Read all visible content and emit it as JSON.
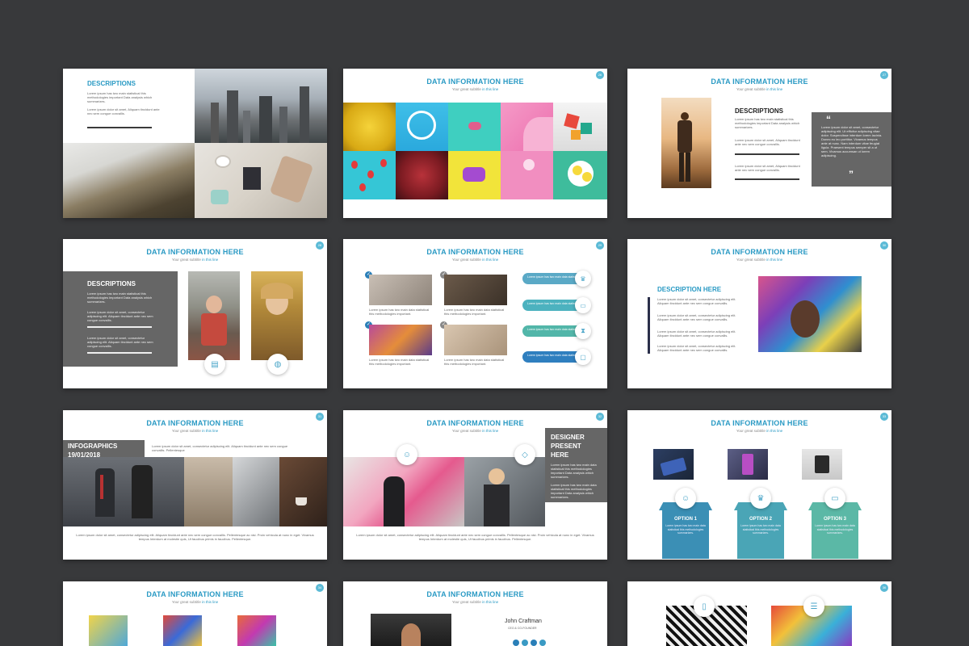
{
  "slides": {
    "s1": {
      "heading": "DESCRIPTIONS",
      "text1": "Lorem ipsum has two main statistical this methodologies important Data analysis which summarizes.",
      "text2": "Lorem ipsum dolor sit amet, Aliquam tincidunt ante nec sem congue convallis."
    },
    "s2": {
      "title": "DATA INFORMATION HERE",
      "sub_a": "Your great subtitle ",
      "sub_b": "in this line",
      "num": "26"
    },
    "s3": {
      "title": "DATA INFORMATION HERE",
      "sub_a": "Your great subtitle ",
      "sub_b": "in this line",
      "num": "27",
      "heading": "DESCRIPTIONS",
      "text1": "Lorem ipsum has two main statistical this methodologies important Data analysis which summarizes.",
      "text2": "Lorem ipsum dolor sit amet, Aliquam tincidunt ante nec sem congue convallis.",
      "text3": "Lorem ipsum dolor sit amet, Aliquam tincidunt ante nec sem congue convallis.",
      "open_quote": "“",
      "close_quote": "”",
      "quote": "Lorem ipsum dolor sit amet, consectetur adipiscing elit. Ut efficitur adipiscing vitae dolor. Suspendisse interdum lorem lacinia. Donec eu leo porttitor. Vivamus tempus ante at nunc. Nam interdum vitae feugiat ligula. Praesent tempus semper sit a ut sem. Vivamus accumsan ut lorem adipiscing."
    },
    "s4": {
      "title": "DATA INFORMATION HERE",
      "sub_a": "Your great subtitle ",
      "sub_b": "in this line",
      "num": "28",
      "heading": "DESCRIPTIONS",
      "text1": "Lorem ipsum has two main statistical this methodologies important Data analysis which summarizes.",
      "text2": "Lorem ipsum dolor sit amet, consectetur adipiscing elit. Aliquam tincidunt ante nec sem congue convallis.",
      "text3": "Lorem ipsum dolor sit amet, consectetur adipiscing elit. Aliquam tincidunt ante nec sem congue convallis."
    },
    "s5": {
      "title": "DATA INFORMATION HERE",
      "sub_a": "Your great subtitle ",
      "sub_b": "in this line",
      "num": "29",
      "cap": "Lorem ipsum has two main data statistical this methodologies important.",
      "pills": [
        "Lorem ipsum has two main data statistical",
        "Lorem ipsum has two main data statistical",
        "Lorem ipsum has two main data statistical",
        "Lorem ipsum has two main data statistical"
      ]
    },
    "s6": {
      "title": "DATA INFORMATION HERE",
      "sub_a": "Your great subtitle ",
      "sub_b": "in this line",
      "num": "30",
      "heading": "DESCRIPTION HERE",
      "text": "Lorem ipsum dolor sit amet, consectetur adipiscing elit. Aliquam tincidunt ante nec sem congue convallis."
    },
    "s7": {
      "title": "DATA INFORMATION HERE",
      "sub_a": "Your great subtitle ",
      "sub_b": "in this line",
      "num": "31",
      "badge_line1": "INFOGRAPHICS",
      "badge_line2": "19/01/2018",
      "intro": "Lorem ipsum dolor sit amet, consectetur adipiscing elit. Aliquam tincidunt ante nec sem congue convallis. Pellentesque",
      "footer": "Lorem ipsum dolor sit amet, consectetur adipiscing elit. Aliquam tincidunt ante nec sem congue convallis. Pellentesque ac nisi. Proin vehicula at nunc in eget. Vivamus tempus Interdum at molestie quis, Ut faucibus primis in faucibus. Pellentesque."
    },
    "s8": {
      "title": "DATA INFORMATION HERE",
      "sub_a": "Your great subtitle ",
      "sub_b": "in this line",
      "num": "32",
      "panel_l1": "DESIGNER",
      "panel_l2": "PRESENT",
      "panel_l3": "HERE",
      "panel_text1": "Lorem ipsum has two main data statistical this methodologies important Data analysis which summarizes.",
      "panel_text2": "Lorem ipsum has two main data statistical this methodologies important Data analysis which summarizes.",
      "footer": "Lorem ipsum dolor sit amet, consectetur adipiscing elit. Aliquam tincidunt ante nec sem congue convallis. Pellentesque ac nisi. Proin vehicula at nunc in eget. Vivamus tempus Interdum at molestie quis, Ut faucibus primis in faucibus. Pellentesque."
    },
    "s9": {
      "title": "DATA INFORMATION HERE",
      "sub_a": "Your great subtitle ",
      "sub_b": "in this line",
      "num": "33",
      "options": [
        {
          "label": "OPTION 1",
          "text": "Lorem ipsum has two main data statistical this methodologies summarizes."
        },
        {
          "label": "OPTION 2",
          "text": "Lorem ipsum has two main data statistical this methodologies summarizes."
        },
        {
          "label": "OPTION 3",
          "text": "Lorem ipsum has two main data statistical this methodologies summarizes."
        }
      ]
    },
    "s10": {
      "title": "DATA INFORMATION HERE",
      "sub_a": "Your great subtitle ",
      "sub_b": "in this line",
      "num": "34"
    },
    "s11": {
      "title": "DATA INFORMATION HERE",
      "sub_a": "Your great subtitle ",
      "sub_b": "in this line",
      "name": "John Craftman",
      "role": "CEO & CO-FOUNDER"
    },
    "s12": {
      "num": "36"
    }
  },
  "colors": {
    "background": "#38393b",
    "accent": "#2a9ac4",
    "panel_gray": "#666666",
    "option1": "#3b8fb5",
    "option2": "#4aa5b6",
    "option3": "#5bb8a6"
  }
}
